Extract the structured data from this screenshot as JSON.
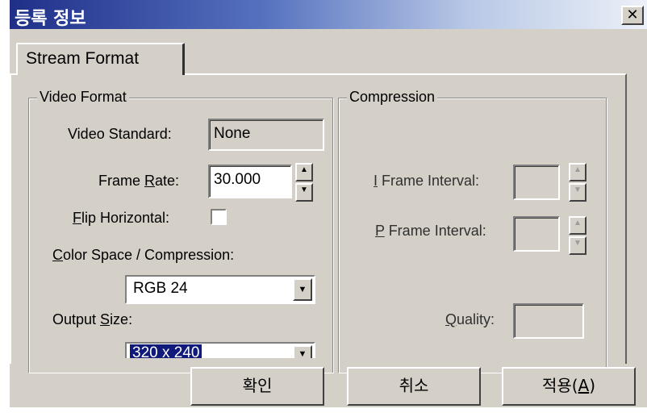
{
  "window": {
    "title": "등록 정보",
    "close_glyph": "✕"
  },
  "tabs": [
    {
      "label": "Stream Format",
      "active": true
    }
  ],
  "video_format": {
    "group_title": "Video Format",
    "video_standard": {
      "label": "Video Standard:",
      "value": "None"
    },
    "frame_rate": {
      "label_pre": "Frame ",
      "label_key": "R",
      "label_post": "ate:",
      "value": "30.000"
    },
    "flip_horizontal": {
      "label_key": "F",
      "label_post": "lip Horizontal:",
      "checked": false
    },
    "color_space": {
      "label_key": "C",
      "label_post": "olor Space / Compression:",
      "selected": "RGB 24"
    },
    "output_size": {
      "label_pre": "Output ",
      "label_key": "S",
      "label_post": "ize:",
      "selected": "320 x 240"
    }
  },
  "compression": {
    "group_title": "Compression",
    "i_frame": {
      "label_key": "I",
      "label_post": " Frame Interval:",
      "value": ""
    },
    "p_frame": {
      "label_key": "P",
      "label_post": " Frame Interval:",
      "value": ""
    },
    "quality": {
      "label_key": "Q",
      "label_post": "uality:",
      "value": ""
    }
  },
  "buttons": {
    "ok": "확인",
    "cancel": "취소",
    "apply_pre": "적용(",
    "apply_key": "A",
    "apply_post": ")"
  },
  "icons": {
    "spin_up": "▲",
    "spin_down": "▼",
    "dropdown": "▼"
  },
  "colors": {
    "titlebar_start": "#1f2f88",
    "titlebar_end": "#ecf0f8",
    "face": "#d4d0c8",
    "selection": "#101a7a"
  }
}
